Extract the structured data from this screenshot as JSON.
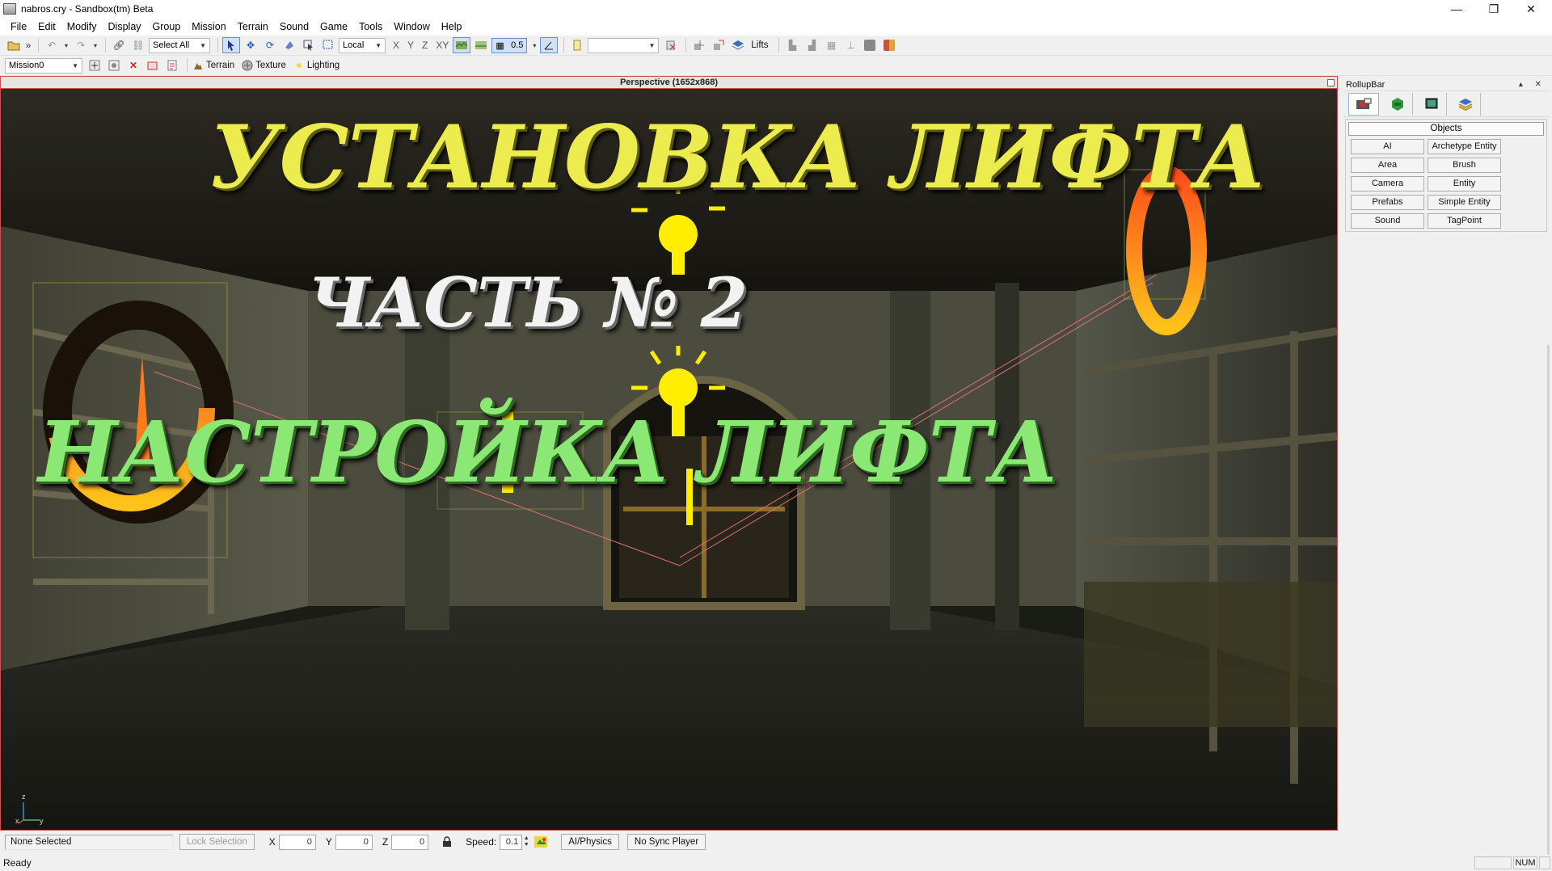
{
  "window": {
    "title": "nabros.cry - Sandbox(tm) Beta",
    "controls": {
      "minimize": "—",
      "restore": "❐",
      "close": "✕"
    }
  },
  "menu": [
    "File",
    "Edit",
    "Modify",
    "Display",
    "Group",
    "Mission",
    "Terrain",
    "Sound",
    "Game",
    "Tools",
    "Window",
    "Help"
  ],
  "toolbar1": {
    "select_combo": "Select All",
    "coord_combo": "Local",
    "axes": [
      "X",
      "Y",
      "Z",
      "XY"
    ],
    "grid_value": "0.5",
    "lifts_label": "Lifts"
  },
  "toolbar2": {
    "mission_combo": "Mission0",
    "terrain_label": "Terrain",
    "texture_label": "Texture",
    "lighting_label": "Lighting"
  },
  "viewport": {
    "title": "Perspective (1652x868)",
    "overlay_line1": "УСТАНОВКА ЛИФТА",
    "overlay_line2": "ЧАСТЬ № 2",
    "overlay_line3": "НАСТРОЙКА ЛИФТА",
    "gizmo": {
      "z": "z",
      "x": "x",
      "y": "y"
    }
  },
  "rollup": {
    "title": "RollupBar",
    "title_controls": "▴ ✕",
    "panel_title": "Objects",
    "buttons": [
      "AI",
      "Archetype Entity",
      "Area",
      "Brush",
      "Camera",
      "Entity",
      "Prefabs",
      "Simple Entity",
      "Sound",
      "TagPoint"
    ]
  },
  "bottom": {
    "selection": "None Selected",
    "lock_selection": "Lock Selection",
    "x_label": "X",
    "x_value": "0",
    "y_label": "Y",
    "y_value": "0",
    "z_label": "Z",
    "z_value": "0",
    "speed_label": "Speed:",
    "speed_value": "0.1",
    "ai_physics": "AI/Physics",
    "no_sync": "No Sync Player"
  },
  "status": {
    "text": "Ready",
    "num": "NUM"
  }
}
